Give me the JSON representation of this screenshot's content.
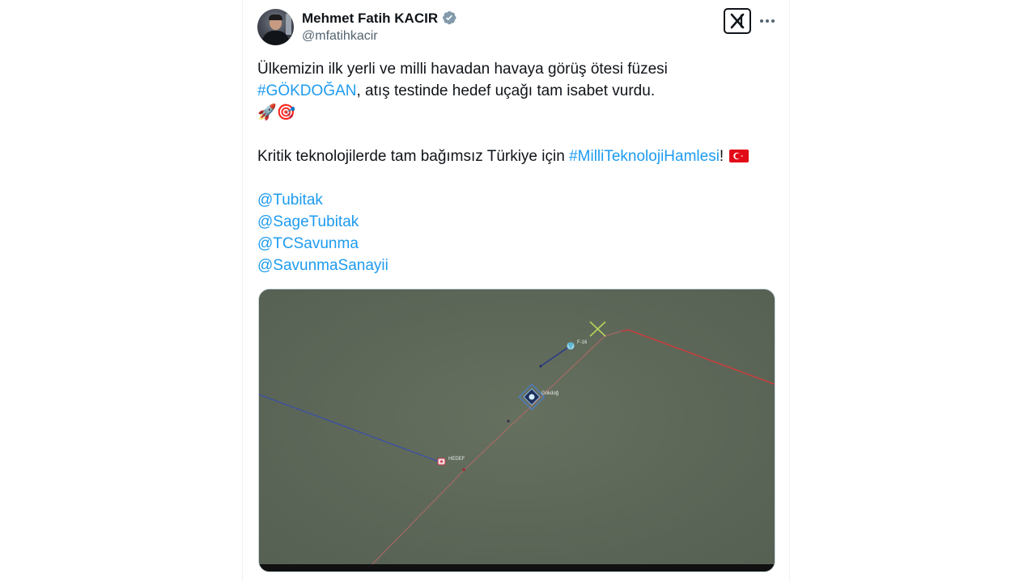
{
  "tweet": {
    "author_name": "Mehmet Fatih KACIR",
    "handle": "@mfatihkacir",
    "line1": "Ülkemizin ilk yerli ve milli havadan havaya görüş ötesi füzesi",
    "hashtag1": "#GÖKDOĞAN",
    "line2_rest": ", atış testinde hedef uçağı tam isabet vurdu.",
    "emoji_line": "🚀🎯",
    "line3_start": "Kritik teknolojilerde tam bağımsız Türkiye için ",
    "hashtag2": "#MilliTeknolojiHamlesi",
    "line3_end": "!",
    "mentions": [
      "@Tubitak",
      "@SageTubitak",
      "@TCSavunma",
      "@SavunmaSanayii"
    ]
  },
  "icons": {
    "verified": "verified-badge-icon",
    "x_logo": "x-logo-icon",
    "more": "more-options-icon",
    "flag": "turkey-flag-icon"
  },
  "media": {
    "labels": {
      "f16": "F-16",
      "gokdogan": "Gökdoğ",
      "hedef": "HEDEF"
    }
  },
  "colors": {
    "link": "#1d9bf0",
    "text": "#0f1419",
    "secondary": "#536471",
    "map_bg": "#5f6a5f",
    "red_track": "#d23a3a",
    "blue_track": "#3a4fa8"
  }
}
